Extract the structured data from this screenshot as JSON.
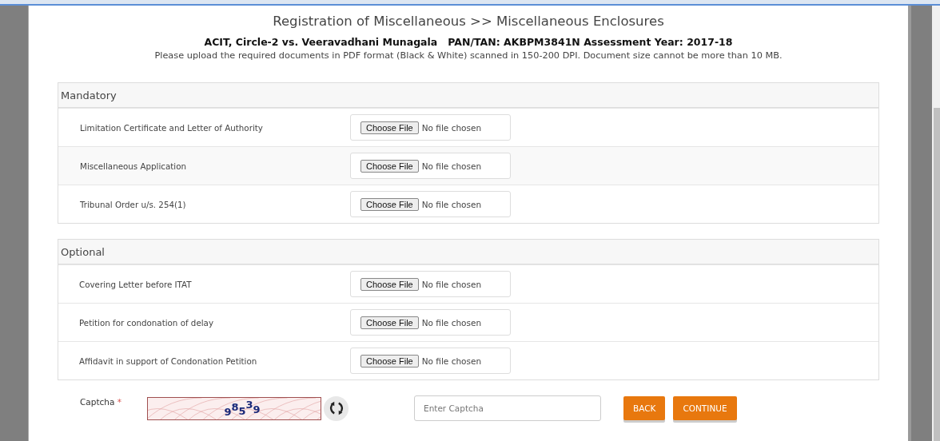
{
  "page": {
    "title": "Registration of Miscellaneous >> Miscellaneous Enclosures",
    "case_line": "ACIT, Circle-2 vs. Veeravadhani Munagala   PAN/TAN: AKBPM3841N Assessment Year: 2017-18",
    "note": "Please upload the required documents in PDF format (Black & White) scanned in 150-200 DPI. Document size cannot be more than 10 MB."
  },
  "sections": [
    {
      "heading": "Mandatory",
      "rows": [
        {
          "label": "Limitation Certificate and Letter of Authority",
          "button": "Choose File",
          "status": "No file chosen"
        },
        {
          "label": "Miscellaneous Application",
          "button": "Choose File",
          "status": "No file chosen"
        },
        {
          "label": "Tribunal Order u/s. 254(1)",
          "button": "Choose File",
          "status": "No file chosen"
        }
      ]
    },
    {
      "heading": "Optional",
      "rows": [
        {
          "label": "Covering Letter before ITAT",
          "button": "Choose File",
          "status": "No file chosen"
        },
        {
          "label": "Petition for condonation of delay",
          "button": "Choose File",
          "status": "No file chosen"
        },
        {
          "label": "Affidavit in support of Condonation Petition",
          "button": "Choose File",
          "status": "No file chosen"
        }
      ]
    }
  ],
  "captcha": {
    "label": "Captcha",
    "required_mark": "*",
    "code": "98539",
    "placeholder": "Enter Captcha"
  },
  "buttons": [
    "BACK",
    "CONTINUE"
  ]
}
